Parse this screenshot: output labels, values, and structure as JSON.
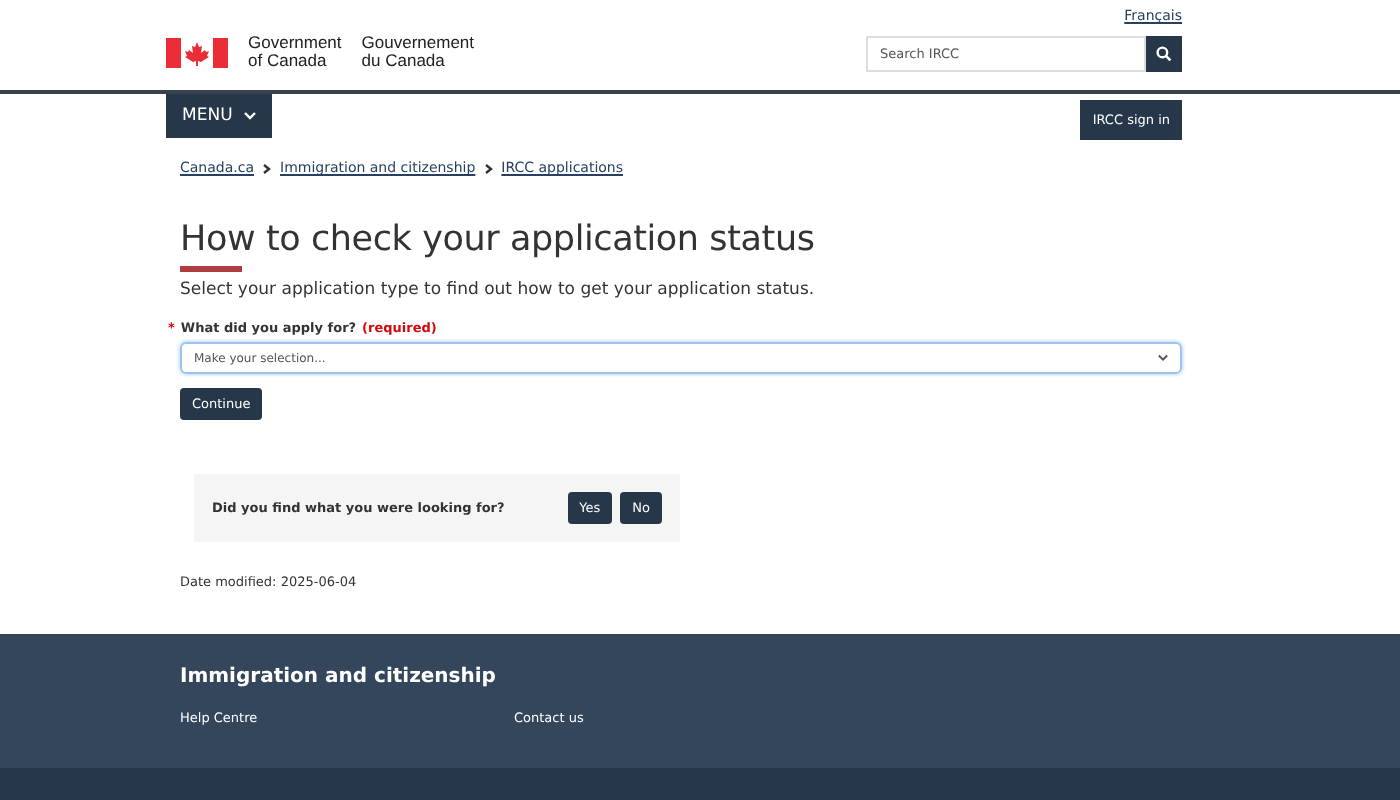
{
  "header": {
    "gov_en": [
      "Government",
      "of Canada"
    ],
    "gov_fr": [
      "Gouvernement",
      "du Canada"
    ],
    "language_link": "Français",
    "search": {
      "placeholder": "Search IRCC"
    }
  },
  "nav": {
    "menu": "MENU",
    "sign_in": "IRCC sign in"
  },
  "breadcrumbs": [
    "Canada.ca",
    "Immigration and citizenship",
    "IRCC applications"
  ],
  "title": "How to check your application status",
  "intro": "Select your application type to find out how to get your application status.",
  "form": {
    "label": "What did you apply for?",
    "required_mark": "*",
    "required_text": "(required)",
    "select": {
      "placeholder": "Make your selection..."
    },
    "submit": "Continue"
  },
  "feedback": {
    "question": "Did you find what you were looking for?",
    "buttons": [
      "Yes",
      "No"
    ]
  },
  "date_modified": "Date modified: 2025-06-04",
  "footer": {
    "title": "Immigration and citizenship",
    "links": [
      "Help Centre",
      "Contact us"
    ]
  }
}
